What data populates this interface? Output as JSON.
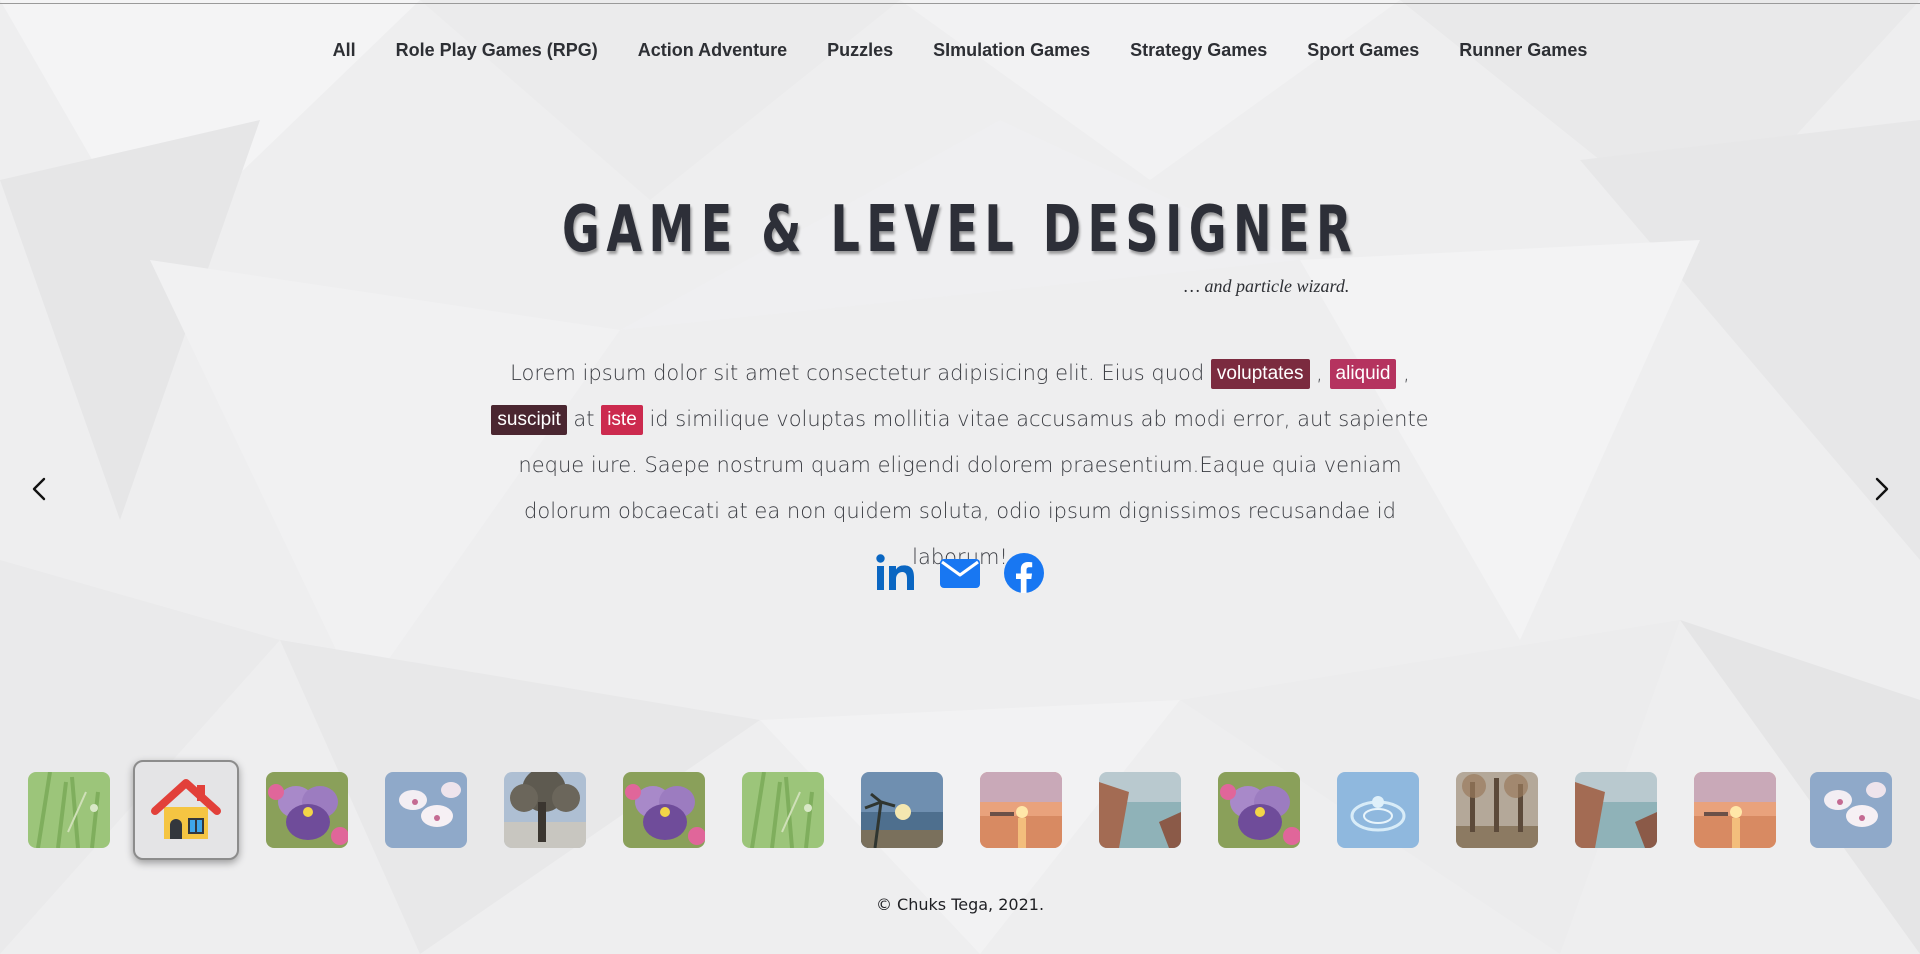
{
  "nav": {
    "items": [
      {
        "label": "All"
      },
      {
        "label": "Role Play Games (RPG)"
      },
      {
        "label": "Action Adventure"
      },
      {
        "label": "Puzzles"
      },
      {
        "label": "SImulation Games"
      },
      {
        "label": "Strategy Games"
      },
      {
        "label": "Sport Games"
      },
      {
        "label": "Runner Games"
      }
    ]
  },
  "hero": {
    "title": "GAME & LEVEL DESIGNER",
    "subtitle": "… and particle wizard.",
    "text": {
      "part1": "Lorem ipsum dolor sit amet consectetur adipisicing elit. Eius quod ",
      "tag1": "voluptates",
      "comma1": " , ",
      "tag2": "aliquid",
      "comma2": " ,",
      "tag3": "suscipit",
      "at": " at ",
      "tag4": "iste",
      "part2": " id similique voluptas mollitia vitae accusamus ab modi error, aut sapiente neque iure. Saepe nostrum quam eligendi dolorem praesentium.Eaque quia veniam dolorum obcaecati at ea non quidem soluta, odio ipsum dignissimos recusandae id laborum!"
    }
  },
  "social": {
    "icons": [
      "linkedin-icon",
      "mail-icon",
      "facebook-icon"
    ],
    "colors": {
      "linkedin": "#0a66c2",
      "mail": "#1877f2",
      "facebook": "#1877f2"
    }
  },
  "carousel": {
    "thumbnails": [
      "grass",
      "home",
      "pansy",
      "orchid",
      "tree",
      "pansy",
      "grass",
      "palm-beach",
      "sunset-lake",
      "coast",
      "pansy",
      "water-drop",
      "autumn-trees",
      "coast",
      "sunset-lake",
      "orchid"
    ],
    "active_index": 1
  },
  "tag_colors": {
    "voluptates": "#7b2b3f",
    "aliquid": "#b5335f",
    "suscipit": "#4a2630",
    "iste": "#cc2a4e"
  },
  "footer": {
    "copyright": "© Chuks Tega, 2021."
  }
}
